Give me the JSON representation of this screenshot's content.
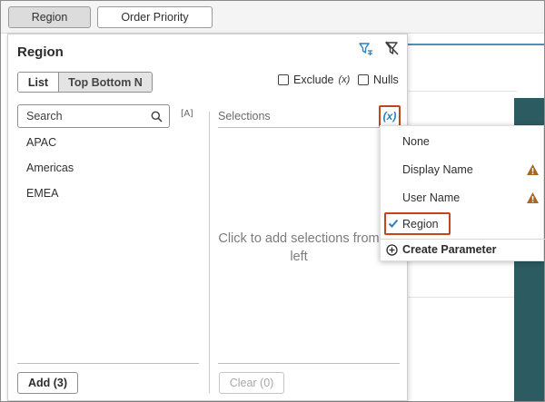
{
  "filter_bar": {
    "chips": [
      "Region",
      "Order Priority"
    ]
  },
  "popup": {
    "title": "Region",
    "modes": {
      "list": "List",
      "top_bottom": "Top Bottom N"
    },
    "exclude_label": "Exclude",
    "exclude_icon_text": "(x)",
    "nulls_label": "Nulls",
    "search": {
      "placeholder": "Search",
      "value": ""
    },
    "case_icon_text": "[A]",
    "values": [
      "APAC",
      "Americas",
      "EMEA"
    ],
    "selections_label": "Selections",
    "parameter_button_text": "(x)",
    "empty_hint": "Click to add selections from left",
    "add_button": "Add (3)",
    "clear_button": "Clear (0)"
  },
  "parameter_menu": {
    "items": [
      {
        "label": "None",
        "warning": false,
        "selected": false
      },
      {
        "label": "Display Name",
        "warning": true,
        "selected": false
      },
      {
        "label": "User Name",
        "warning": true,
        "selected": false
      },
      {
        "label": "Region",
        "warning": false,
        "selected": true
      }
    ],
    "create_label": "Create Parameter"
  },
  "colors": {
    "accent_blue": "#2e7fbf",
    "highlight_orange": "#c0461e",
    "warning_brown": "#a8661f",
    "teal_panel": "#2c5b61"
  }
}
